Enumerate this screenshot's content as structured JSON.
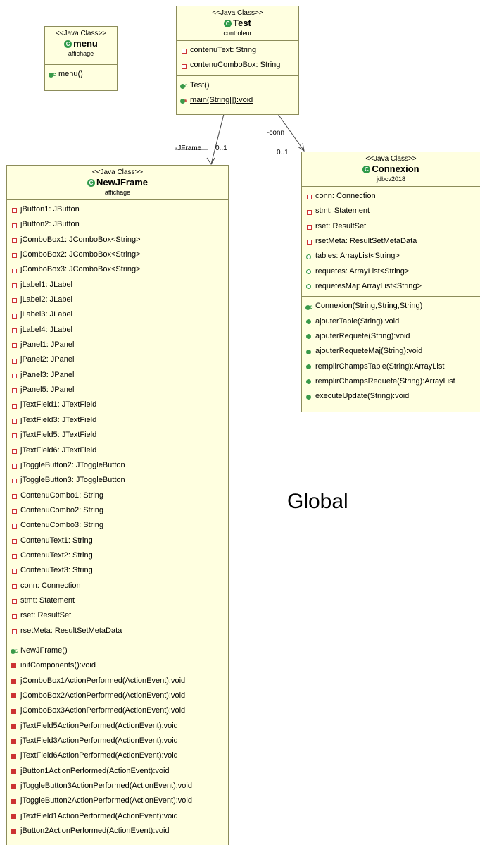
{
  "classes": {
    "menu": {
      "stereotype": "<<Java Class>>",
      "name": "menu",
      "package": "affichage",
      "attributes": [],
      "methods": [
        {
          "text": "menu()",
          "kind": "ctor"
        }
      ]
    },
    "test": {
      "stereotype": "<<Java Class>>",
      "name": "Test",
      "package": "controleur",
      "attributes": [
        {
          "text": "contenuText: String",
          "kind": "priv"
        },
        {
          "text": "contenuComboBox: String",
          "kind": "priv"
        }
      ],
      "methods": [
        {
          "text": "Test()",
          "kind": "ctor"
        },
        {
          "text": "main(String[]):void",
          "kind": "static"
        }
      ]
    },
    "connexion": {
      "stereotype": "<<Java Class>>",
      "name": "Connexion",
      "package": "jdbcv2018",
      "attributes": [
        {
          "text": "conn: Connection",
          "kind": "priv"
        },
        {
          "text": "stmt: Statement",
          "kind": "priv"
        },
        {
          "text": "rset: ResultSet",
          "kind": "priv"
        },
        {
          "text": "rsetMeta: ResultSetMetaData",
          "kind": "priv"
        },
        {
          "text": "tables: ArrayList<String>",
          "kind": "pub"
        },
        {
          "text": "requetes: ArrayList<String>",
          "kind": "pub"
        },
        {
          "text": "requetesMaj: ArrayList<String>",
          "kind": "pub"
        }
      ],
      "methods": [
        {
          "text": "Connexion(String,String,String)",
          "kind": "ctor"
        },
        {
          "text": "ajouterTable(String):void",
          "kind": "pubm"
        },
        {
          "text": "ajouterRequete(String):void",
          "kind": "pubm"
        },
        {
          "text": "ajouterRequeteMaj(String):void",
          "kind": "pubm"
        },
        {
          "text": "remplirChampsTable(String):ArrayList",
          "kind": "pubm"
        },
        {
          "text": "remplirChampsRequete(String):ArrayList",
          "kind": "pubm"
        },
        {
          "text": "executeUpdate(String):void",
          "kind": "pubm"
        }
      ]
    },
    "newjframe": {
      "stereotype": "<<Java Class>>",
      "name": "NewJFrame",
      "package": "affichage",
      "attributes": [
        {
          "text": "jButton1: JButton",
          "kind": "priv"
        },
        {
          "text": "jButton2: JButton",
          "kind": "priv"
        },
        {
          "text": "jComboBox1: JComboBox<String>",
          "kind": "priv"
        },
        {
          "text": "jComboBox2: JComboBox<String>",
          "kind": "priv"
        },
        {
          "text": "jComboBox3: JComboBox<String>",
          "kind": "priv"
        },
        {
          "text": "jLabel1: JLabel",
          "kind": "priv"
        },
        {
          "text": "jLabel2: JLabel",
          "kind": "priv"
        },
        {
          "text": "jLabel3: JLabel",
          "kind": "priv"
        },
        {
          "text": "jLabel4: JLabel",
          "kind": "priv"
        },
        {
          "text": "jPanel1: JPanel",
          "kind": "priv"
        },
        {
          "text": "jPanel2: JPanel",
          "kind": "priv"
        },
        {
          "text": "jPanel3: JPanel",
          "kind": "priv"
        },
        {
          "text": "jPanel5: JPanel",
          "kind": "priv"
        },
        {
          "text": "jTextField1: JTextField",
          "kind": "priv"
        },
        {
          "text": "jTextField3: JTextField",
          "kind": "priv"
        },
        {
          "text": "jTextField5: JTextField",
          "kind": "priv"
        },
        {
          "text": "jTextField6: JTextField",
          "kind": "priv"
        },
        {
          "text": "jToggleButton2: JToggleButton",
          "kind": "priv"
        },
        {
          "text": "jToggleButton3: JToggleButton",
          "kind": "priv"
        },
        {
          "text": "ContenuCombo1: String",
          "kind": "priv"
        },
        {
          "text": "ContenuCombo2: String",
          "kind": "priv"
        },
        {
          "text": "ContenuCombo3: String",
          "kind": "priv"
        },
        {
          "text": "ContenuText1: String",
          "kind": "priv"
        },
        {
          "text": "ContenuText2: String",
          "kind": "priv"
        },
        {
          "text": "ContenuText3: String",
          "kind": "priv"
        },
        {
          "text": "conn: Connection",
          "kind": "priv"
        },
        {
          "text": "stmt: Statement",
          "kind": "priv"
        },
        {
          "text": "rset: ResultSet",
          "kind": "priv"
        },
        {
          "text": "rsetMeta: ResultSetMetaData",
          "kind": "priv"
        }
      ],
      "methods": [
        {
          "text": "NewJFrame()",
          "kind": "ctor"
        },
        {
          "text": "initComponents():void",
          "kind": "privm"
        },
        {
          "text": "jComboBox1ActionPerformed(ActionEvent):void",
          "kind": "privm"
        },
        {
          "text": "jComboBox2ActionPerformed(ActionEvent):void",
          "kind": "privm"
        },
        {
          "text": "jComboBox3ActionPerformed(ActionEvent):void",
          "kind": "privm"
        },
        {
          "text": "jTextField5ActionPerformed(ActionEvent):void",
          "kind": "privm"
        },
        {
          "text": "jTextField3ActionPerformed(ActionEvent):void",
          "kind": "privm"
        },
        {
          "text": "jTextField6ActionPerformed(ActionEvent):void",
          "kind": "privm"
        },
        {
          "text": "jButton1ActionPerformed(ActionEvent):void",
          "kind": "privm"
        },
        {
          "text": "jToggleButton3ActionPerformed(ActionEvent):void",
          "kind": "privm"
        },
        {
          "text": "jToggleButton2ActionPerformed(ActionEvent):void",
          "kind": "privm"
        },
        {
          "text": "jTextField1ActionPerformed(ActionEvent):void",
          "kind": "privm"
        },
        {
          "text": "jButton2ActionPerformed(ActionEvent):void",
          "kind": "privm"
        }
      ]
    }
  },
  "associations": {
    "jframe_role": "-JFrame",
    "jframe_mult": "0..1",
    "conn_role": "-conn",
    "conn_mult": "0..1"
  },
  "caption": "Global"
}
